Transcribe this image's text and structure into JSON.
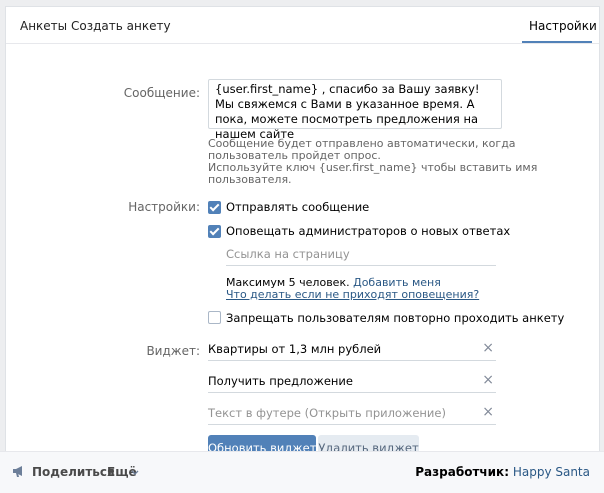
{
  "tabs": {
    "anketi": "Анкеты",
    "create": "Создать анкету",
    "settings": "Настройки"
  },
  "form": {
    "message_label": "Сообщение:",
    "message_value": "{user.first_name} , спасибо за Вашу заявку! Мы свяжемся с Вами в указанное время. А пока, можете посмотреть предложения на нашем сайте",
    "hint_line1": "Сообщение будет отправлено автоматически, когда",
    "hint_line2": "пользователь пройдет опрос.",
    "hint_line3": "Используйте ключ {user.first_name} чтобы вставить имя",
    "hint_line4": "пользователя.",
    "settings_label": "Настройки:",
    "cb_send": {
      "label": "Отправлять сообщение",
      "checked": true
    },
    "cb_notify": {
      "label": "Оповещать администраторов о новых ответах",
      "checked": true
    },
    "page_link_placeholder": "Ссылка на страницу",
    "max_text": "Максимум 5 человек.",
    "add_me": "Добавить меня",
    "no_notifications_link": "Что делать если не приходят оповещения?",
    "cb_forbid": {
      "label": "Запрещать пользователям повторно проходить анкету",
      "checked": false
    },
    "widget_label": "Виджет:",
    "widget_title": "Квартиры от 1,3 млн рублей",
    "widget_button": "Получить предложение",
    "widget_footer_placeholder": "Текст в футере (Открыть приложение)",
    "clear_icon": "×",
    "update_widget": "Обновить виджет",
    "delete_widget": "Удалить виджет"
  },
  "footer": {
    "share": "Поделиться",
    "more": "Ещё",
    "developer_label": "Разработчик:",
    "developer_name": "Happy Santa"
  }
}
